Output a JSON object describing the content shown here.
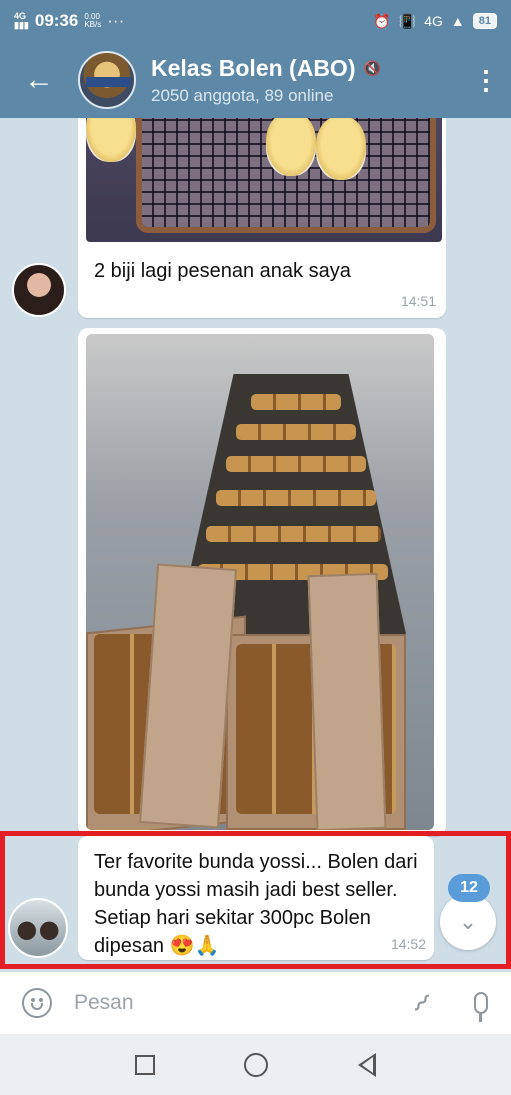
{
  "status_bar": {
    "network": "4G",
    "time": "09:36",
    "speed_value": "0.00",
    "speed_unit": "KB/s",
    "dots": "···",
    "signal_type": "4G",
    "battery": "81"
  },
  "header": {
    "back_icon": "arrow-left-icon",
    "title": "Kelas Bolen (ABO)",
    "muted_icon": "muted-icon",
    "subtitle": "2050 anggota, 89 online",
    "menu_icon": "more-vertical-icon"
  },
  "messages": [
    {
      "type": "photo_with_caption",
      "caption": "2 biji lagi pesenan anak saya",
      "time": "14:51"
    },
    {
      "type": "photo"
    },
    {
      "type": "text",
      "text": "Ter favorite bunda yossi... Bolen dari bunda yossi masih jadi best seller. Setiap hari sekitar 300pc Bolen dipesan",
      "emojis": "😍🙏",
      "time": "14:52"
    }
  ],
  "unread_count": "12",
  "input": {
    "placeholder": "Pesan",
    "value": ""
  },
  "colors": {
    "header_bg": "#5d88a8",
    "chat_bg": "#cfdde6",
    "highlight": "#e31e24",
    "badge": "#5a9cd9"
  }
}
